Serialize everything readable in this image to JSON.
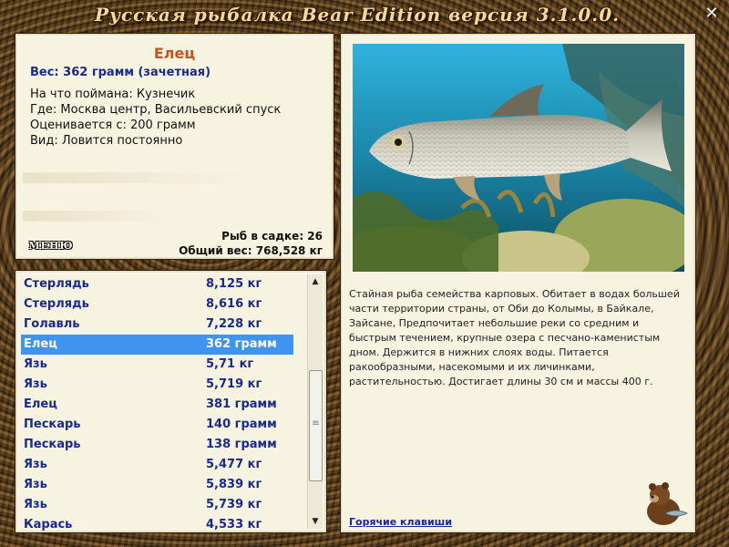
{
  "window": {
    "title": "Русская рыбалка   Bear Edition  версия  3.1.0.0.",
    "close_glyph": "✕"
  },
  "catch_info": {
    "fish_name": "Елец",
    "weight_line": "Вес: 362 грамм (зачетная)",
    "bait_line": "На что поймана: Кузнечик",
    "place_line": "Где: Москва центр, Васильевский спуск",
    "rating_line": "Оценивается с: 200 грамм",
    "type_line": "Вид: Ловится постоянно",
    "menu_label": "МЕНЮ",
    "cage_count_line": "Рыб в садке: 26",
    "total_weight_line": "Общий вес: 768,528 кг"
  },
  "catch_list": [
    {
      "name": "Стерлядь",
      "weight": "8,125 кг"
    },
    {
      "name": "Стерлядь",
      "weight": "8,616 кг"
    },
    {
      "name": "Голавль",
      "weight": "7,228 кг"
    },
    {
      "name": "Елец",
      "weight": "362 грамм",
      "selected": true
    },
    {
      "name": "Язь",
      "weight": "5,71 кг"
    },
    {
      "name": "Язь",
      "weight": "5,719 кг"
    },
    {
      "name": "Елец",
      "weight": "381 грамм"
    },
    {
      "name": "Пескарь",
      "weight": "140 грамм"
    },
    {
      "name": "Пескарь",
      "weight": "138 грамм"
    },
    {
      "name": "Язь",
      "weight": "5,477 кг"
    },
    {
      "name": "Язь",
      "weight": "5,839 кг"
    },
    {
      "name": "Язь",
      "weight": "5,739 кг"
    },
    {
      "name": "Карась",
      "weight": "4,533 кг"
    }
  ],
  "scrollbar": {
    "up_glyph": "▲",
    "down_glyph": "▼"
  },
  "description": {
    "text": "Стайная рыба семейства карповых. Обитает в водах большей части территории страны, от Оби до Колымы, в Байкале, Зайсане, Предпочитает небольшие реки со средним и быстрым течением, крупные озера с песчано-каменистым дном. Держится в нижних слоях воды. Питается ракообразными, насекомыми и их личинками, растительностью. Достигает длины 30 см и массы 400 г.",
    "hotkeys_link": "Горячие клавиши"
  },
  "colors": {
    "selection": "#3f93f1",
    "list_text": "#1a2a8c",
    "fish_name": "#c4541c",
    "panel_bg": "#f6f3e1"
  }
}
